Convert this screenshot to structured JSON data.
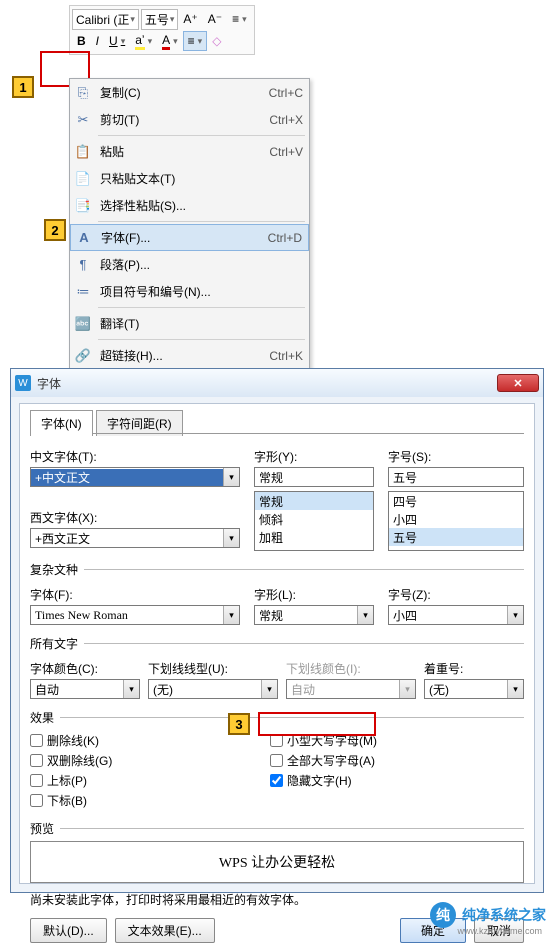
{
  "toolbar": {
    "font": "Calibri (正",
    "size": "五号",
    "incFont": "A⁺",
    "decFont": "A⁻",
    "lineSpace": "≡",
    "bold": "B",
    "italic": "I",
    "underline": "U",
    "highlight": "aʼ",
    "fontColor": "A",
    "align": "≡",
    "eraser": "◇"
  },
  "callouts": {
    "c1": "1",
    "c2": "2",
    "c3": "3"
  },
  "menu": [
    {
      "icon": "⎘",
      "label": "复制(C)",
      "short": "Ctrl+C"
    },
    {
      "icon": "✂",
      "label": "剪切(T)",
      "short": "Ctrl+X"
    },
    {
      "icon": "📋",
      "label": "粘贴",
      "short": "Ctrl+V"
    },
    {
      "icon": "📄",
      "label": "只粘贴文本(T)",
      "short": ""
    },
    {
      "icon": "📑",
      "label": "选择性粘贴(S)...",
      "short": ""
    },
    {
      "icon": "A",
      "label": "字体(F)...",
      "short": "Ctrl+D",
      "hi": true
    },
    {
      "icon": "¶",
      "label": "段落(P)...",
      "short": ""
    },
    {
      "icon": "≔",
      "label": "项目符号和编号(N)...",
      "short": ""
    },
    {
      "icon": "🔤",
      "label": "翻译(T)",
      "short": ""
    },
    {
      "icon": "🔗",
      "label": "超链接(H)...",
      "short": "Ctrl+K"
    }
  ],
  "dialog": {
    "title": "字体",
    "tabs": {
      "t1": "字体(N)",
      "t2": "字符间距(R)"
    },
    "cnFontLbl": "中文字体(T):",
    "cnFont": "+中文正文",
    "wFontLbl": "西文字体(X):",
    "wFont": "+西文正文",
    "styleLbl": "字形(Y):",
    "style": "常规",
    "styleList": [
      "常规",
      "倾斜",
      "加粗"
    ],
    "sizeLbl": "字号(S):",
    "size": "五号",
    "sizeList": [
      "四号",
      "小四",
      "五号"
    ],
    "complexLbl": "复杂文种",
    "cfLbl": "字体(F):",
    "cfVal": "Times New Roman",
    "csLbl": "字形(L):",
    "csVal": "常规",
    "czLbl": "字号(Z):",
    "czVal": "小四",
    "allTextLbl": "所有文字",
    "colorLbl": "字体颜色(C):",
    "colorVal": "自动",
    "ulineLbl": "下划线线型(U):",
    "ulineVal": "(无)",
    "ucolorLbl": "下划线颜色(I):",
    "ucolorVal": "自动",
    "emphLbl": "着重号:",
    "emphVal": "(无)",
    "effectLbl": "效果",
    "strike": "删除线(K)",
    "dstrike": "双删除线(G)",
    "sup": "上标(P)",
    "sub": "下标(B)",
    "smallcaps": "小型大写字母(M)",
    "allcaps": "全部大写字母(A)",
    "hidden": "隐藏文字(H)",
    "previewLbl": "预览",
    "previewText": "WPS 让办公更轻松",
    "note": "尚未安装此字体，打印时将采用最相近的有效字体。",
    "defBtn": "默认(D)...",
    "effBtn": "文本效果(E)...",
    "okBtn": "确定",
    "cancelBtn": "取消"
  },
  "watermark": {
    "brand": "纯净系统之家",
    "url": "www.kzmyhome.com"
  }
}
